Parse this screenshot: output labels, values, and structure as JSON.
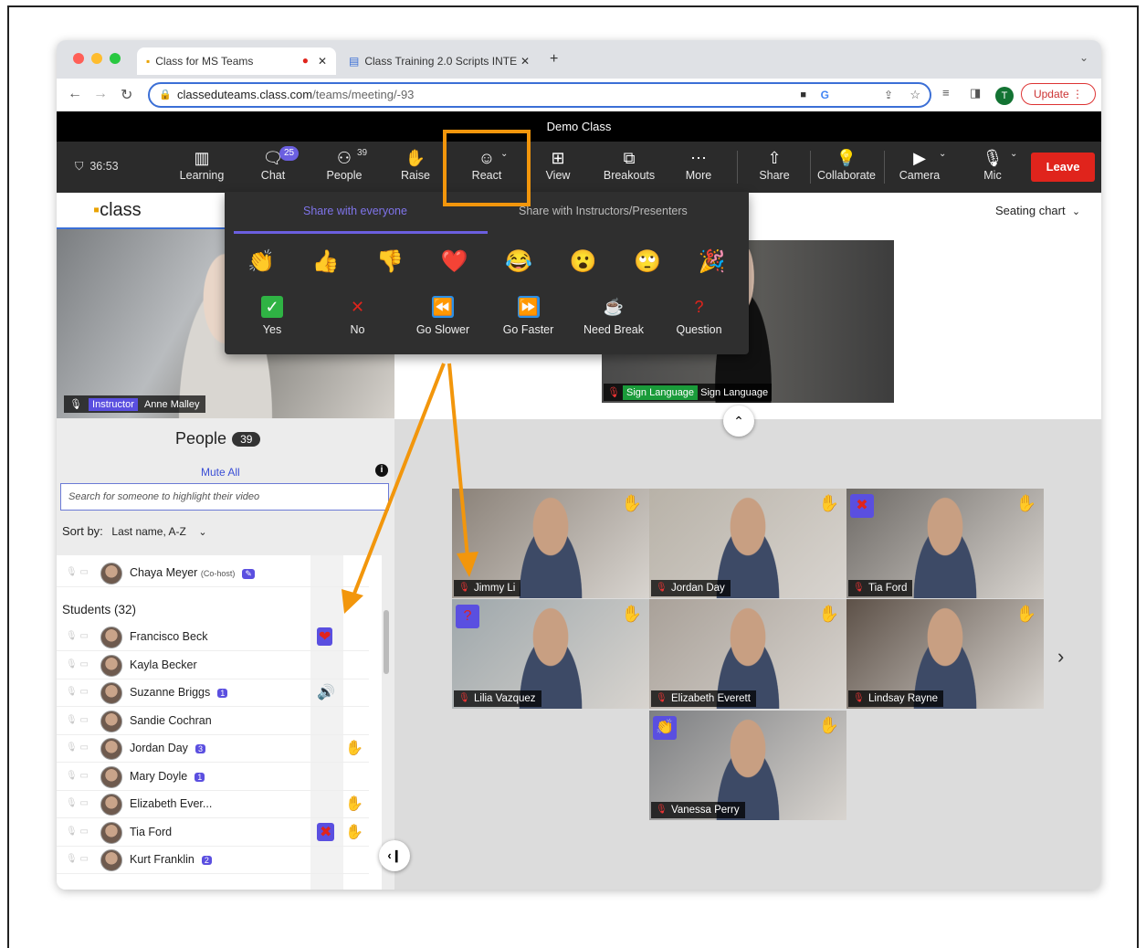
{
  "browser": {
    "tabs": [
      {
        "title": "Class for MS Teams"
      },
      {
        "title": "Class Training 2.0 Scripts INTE"
      }
    ],
    "new_tab": "+",
    "url_domain": "classeduteams.class.com",
    "url_path": "/teams/meeting/-93",
    "update_label": "Update",
    "profile_initial": "T"
  },
  "meeting": {
    "title": "Demo Class",
    "timer": "36:53",
    "toolbar": [
      {
        "label": "Learning",
        "icon": "learning-icon"
      },
      {
        "label": "Chat",
        "icon": "chat-icon",
        "badge": "25"
      },
      {
        "label": "People",
        "icon": "people-icon",
        "badge": "39"
      },
      {
        "label": "Raise",
        "icon": "raise-hand-icon"
      },
      {
        "label": "React",
        "icon": "smile-icon"
      },
      {
        "label": "View",
        "icon": "view-icon"
      },
      {
        "label": "Breakouts",
        "icon": "breakouts-icon"
      },
      {
        "label": "More",
        "icon": "more-icon"
      },
      {
        "label": "Share",
        "icon": "share-icon"
      },
      {
        "label": "Collaborate",
        "icon": "lightbulb-icon"
      },
      {
        "label": "Camera",
        "icon": "camera-off-icon"
      },
      {
        "label": "Mic",
        "icon": "mic-off-icon"
      }
    ],
    "leave_label": "Leave",
    "logo_text": "class",
    "seating_chart": "Seating chart"
  },
  "react_popup": {
    "tab_everyone": "Share with everyone",
    "tab_instructors": "Share with Instructors/Presenters",
    "emojis": [
      "👏",
      "👍",
      "👎",
      "❤️",
      "😂",
      "😮",
      "🙄",
      "🎉"
    ],
    "buttons": [
      {
        "label": "Yes",
        "glyph": "✓",
        "color": "#2fb344"
      },
      {
        "label": "No",
        "glyph": "✕",
        "color": "#e0241c"
      },
      {
        "label": "Go Slower",
        "glyph": "⏪",
        "color": "#2b8fe6"
      },
      {
        "label": "Go Faster",
        "glyph": "⏩",
        "color": "#2b8fe6"
      },
      {
        "label": "Need Break",
        "glyph": "☕",
        "color": "#5a4a3a"
      },
      {
        "label": "Question",
        "glyph": "?",
        "color": "#e0241c"
      }
    ]
  },
  "instructor": {
    "role": "Instructor",
    "name": "Anne Malley"
  },
  "sign_language": {
    "tag": "Sign Language",
    "name": "Sign Language"
  },
  "people_panel": {
    "title": "People",
    "count": "39",
    "mute_all": "Mute All",
    "search_placeholder": "Search for someone to highlight their video",
    "sort_label": "Sort by:",
    "sort_value": "Last name, A-Z",
    "cohost": {
      "name": "Chaya Meyer",
      "role": "(Co-host)"
    },
    "students_header": "Students (32)",
    "students": [
      {
        "name": "Francisco Beck",
        "badge": "",
        "react": "❤",
        "react2": ""
      },
      {
        "name": "Kayla Becker",
        "badge": "",
        "react": "",
        "react2": ""
      },
      {
        "name": "Suzanne Briggs",
        "badge": "1",
        "react": "🔊",
        "react2": ""
      },
      {
        "name": "Sandie Cochran",
        "badge": "",
        "react": "",
        "react2": ""
      },
      {
        "name": "Jordan Day",
        "badge": "3",
        "react": "",
        "react2": "✋"
      },
      {
        "name": "Mary Doyle",
        "badge": "1",
        "react": "",
        "react2": ""
      },
      {
        "name": "Elizabeth Ever...",
        "badge": "",
        "react": "",
        "react2": "✋"
      },
      {
        "name": "Tia Ford",
        "badge": "",
        "react": "✖",
        "react2": "✋"
      },
      {
        "name": "Kurt Franklin",
        "badge": "2",
        "react": "",
        "react2": ""
      }
    ]
  },
  "video_tiles": [
    {
      "name": "Jimmy Li",
      "hand": "✋",
      "overlay": "",
      "bg": "#8a8178"
    },
    {
      "name": "Jordan Day",
      "hand": "✋",
      "overlay": "",
      "bg": "#b8b2a8"
    },
    {
      "name": "Tia Ford",
      "hand": "✋",
      "overlay": "✖",
      "bg": "#6e6a66"
    },
    {
      "name": "Lilia Vazquez",
      "hand": "✋",
      "overlay": "?",
      "bg": "#9ea7ab"
    },
    {
      "name": "Elizabeth Everett",
      "hand": "✋",
      "overlay": "",
      "bg": "#a9a199"
    },
    {
      "name": "Lindsay Rayne",
      "hand": "✋",
      "overlay": "",
      "bg": "#5d5148"
    },
    {
      "name": "Vanessa Perry",
      "hand": "✋",
      "overlay": "👏",
      "bg": "#7d7f82"
    }
  ]
}
